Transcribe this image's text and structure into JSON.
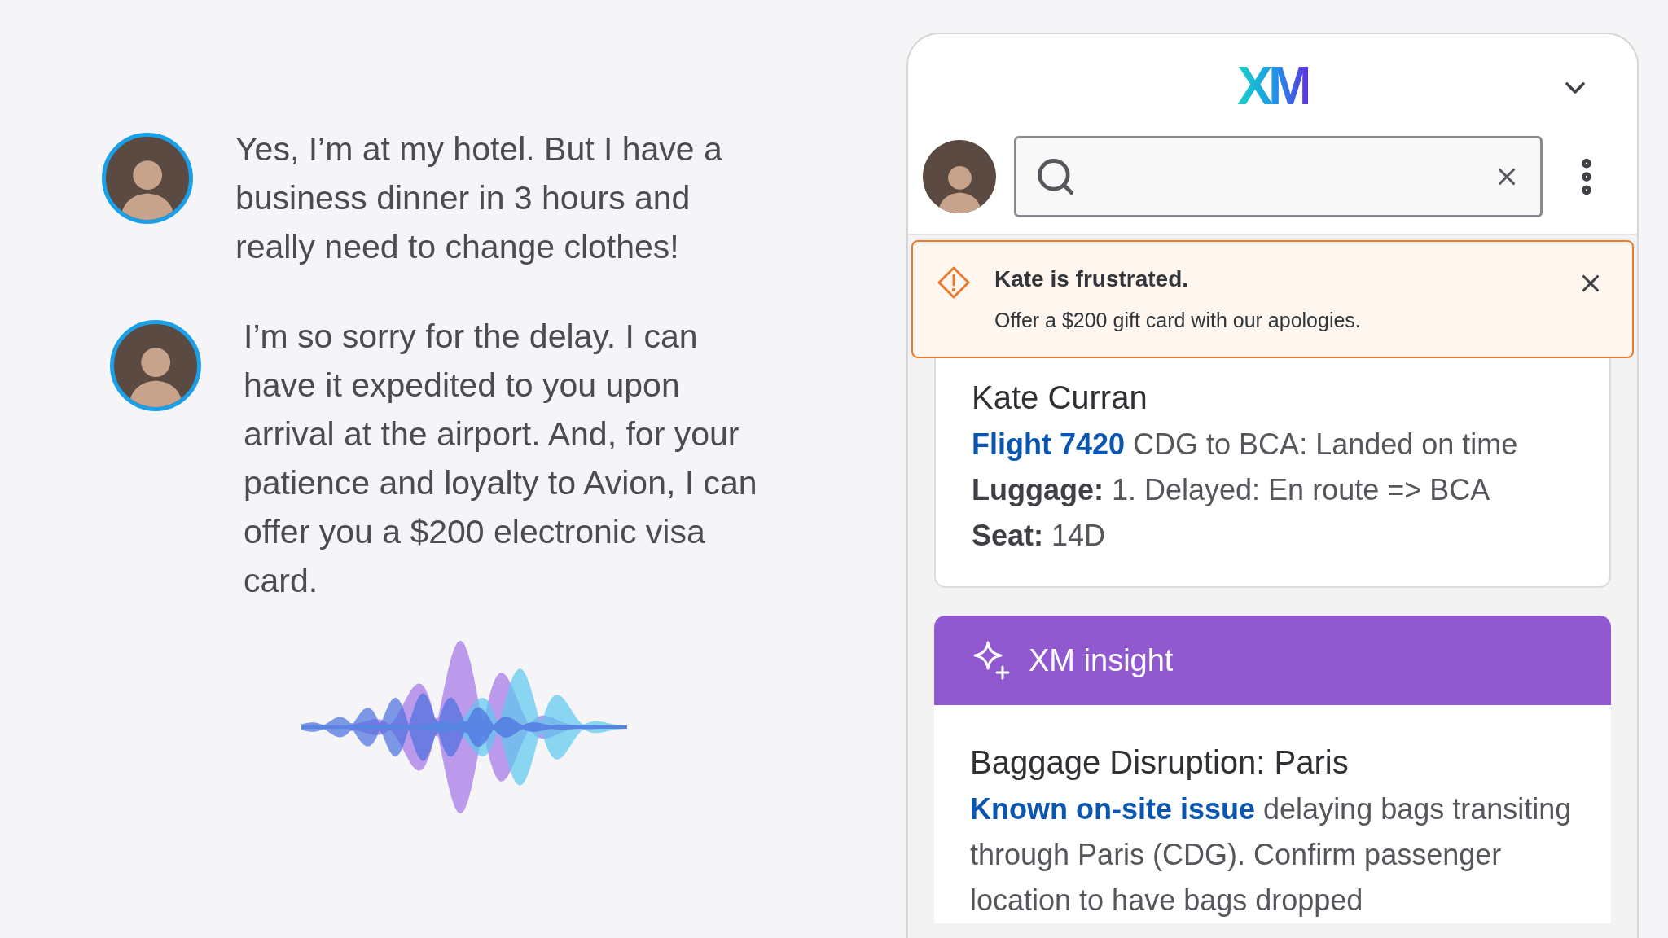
{
  "messages": [
    {
      "text": "Yes, I’m at my hotel. But I have a business dinner in 3 hours and really need to change clothes!"
    },
    {
      "text": "I’m so sorry for the delay. I can have it expedited to you upon arrival at the airport. And, for your patience and loyalty to Avion, I can offer you a $200 electronic visa card."
    }
  ],
  "panel": {
    "logo": "XM",
    "alert": {
      "title": "Kate is frustrated.",
      "message": "Offer a $200 gift card with our apologies."
    },
    "customer": {
      "name": "Kate Curran",
      "flight_link": "Flight 7420",
      "flight_status": "CDG to BCA: Landed on time",
      "details": [
        "**Luggage:** 1. Delayed: En route => BCA",
        "**Seat:** 14D"
      ]
    },
    "insight": {
      "header": "XM insight",
      "title": "Baggage Disruption: Paris",
      "link": "Known on-site issue",
      "body": "delaying bags transiting through Paris (CDG). Confirm passenger location to have bags dropped"
    }
  }
}
